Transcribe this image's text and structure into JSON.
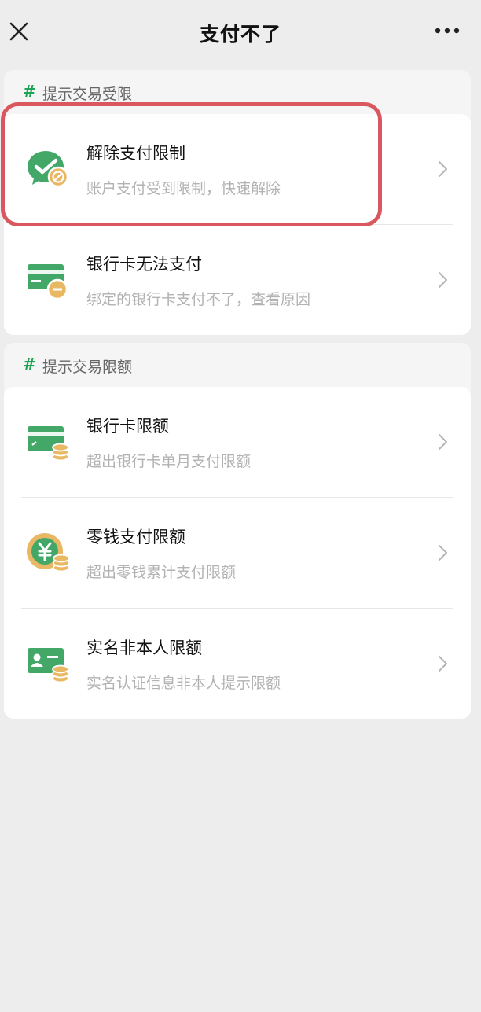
{
  "header": {
    "title": "支付不了"
  },
  "sections": [
    {
      "heading": "提示交易受限",
      "items": [
        {
          "title": "解除支付限制",
          "subtitle": "账户支付受到限制，快速解除",
          "icon": "wechat-pay-restricted-icon"
        },
        {
          "title": "银行卡无法支付",
          "subtitle": "绑定的银行卡支付不了，查看原因",
          "icon": "bank-card-minus-icon"
        }
      ]
    },
    {
      "heading": "提示交易限额",
      "items": [
        {
          "title": "银行卡限额",
          "subtitle": "超出银行卡单月支付限额",
          "icon": "bank-card-coins-icon"
        },
        {
          "title": "零钱支付限额",
          "subtitle": "超出零钱累计支付限额",
          "icon": "yuan-coin-icon"
        },
        {
          "title": "实名非本人限额",
          "subtitle": "实名认证信息非本人提示限额",
          "icon": "id-card-coins-icon"
        }
      ]
    }
  ],
  "colors": {
    "accent": "#21a356",
    "icon_green": "#43a867",
    "coin_gold": "#e9b865",
    "highlight": "#d9575f"
  }
}
